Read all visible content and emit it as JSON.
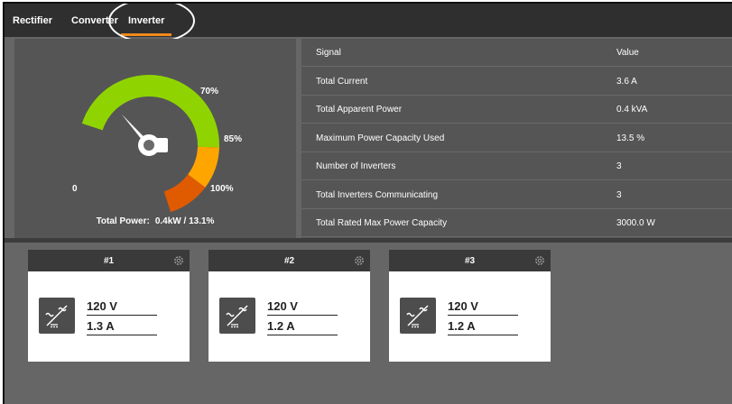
{
  "tabs": [
    "Rectifier",
    "Converter",
    "Inverter"
  ],
  "active_tab": "Inverter",
  "gauge": {
    "labels": {
      "zero": "0",
      "seventy": "70%",
      "eightyfive": "85%",
      "hundred": "100%"
    },
    "value_percent": 13.1,
    "colors": {
      "green": "#8fd400",
      "orange": "#ffa500",
      "red": "#e05a00",
      "needle": "#ffffff"
    },
    "total_power_label": "Total Power:",
    "total_power_value": "0.4kW / 13.1%"
  },
  "signals": {
    "header": {
      "signal": "Signal",
      "value": "Value"
    },
    "rows": [
      {
        "signal": "Total Current",
        "value": "3.6 A"
      },
      {
        "signal": "Total Apparent Power",
        "value": "0.4 kVA"
      },
      {
        "signal": "Maximum Power Capacity Used",
        "value": "13.5 %"
      },
      {
        "signal": "Number of Inverters",
        "value": "3"
      },
      {
        "signal": "Total Inverters Communicating",
        "value": "3"
      },
      {
        "signal": "Total Rated Max Power Capacity",
        "value": "3000.0 W"
      }
    ]
  },
  "inverters": [
    {
      "title": "#1",
      "voltage": "120 V",
      "current": "1.3 A"
    },
    {
      "title": "#2",
      "voltage": "120 V",
      "current": "1.2 A"
    },
    {
      "title": "#3",
      "voltage": "120 V",
      "current": "1.2 A"
    }
  ],
  "icons": {
    "gear": "gear-icon",
    "inverter": "inverter-icon"
  }
}
